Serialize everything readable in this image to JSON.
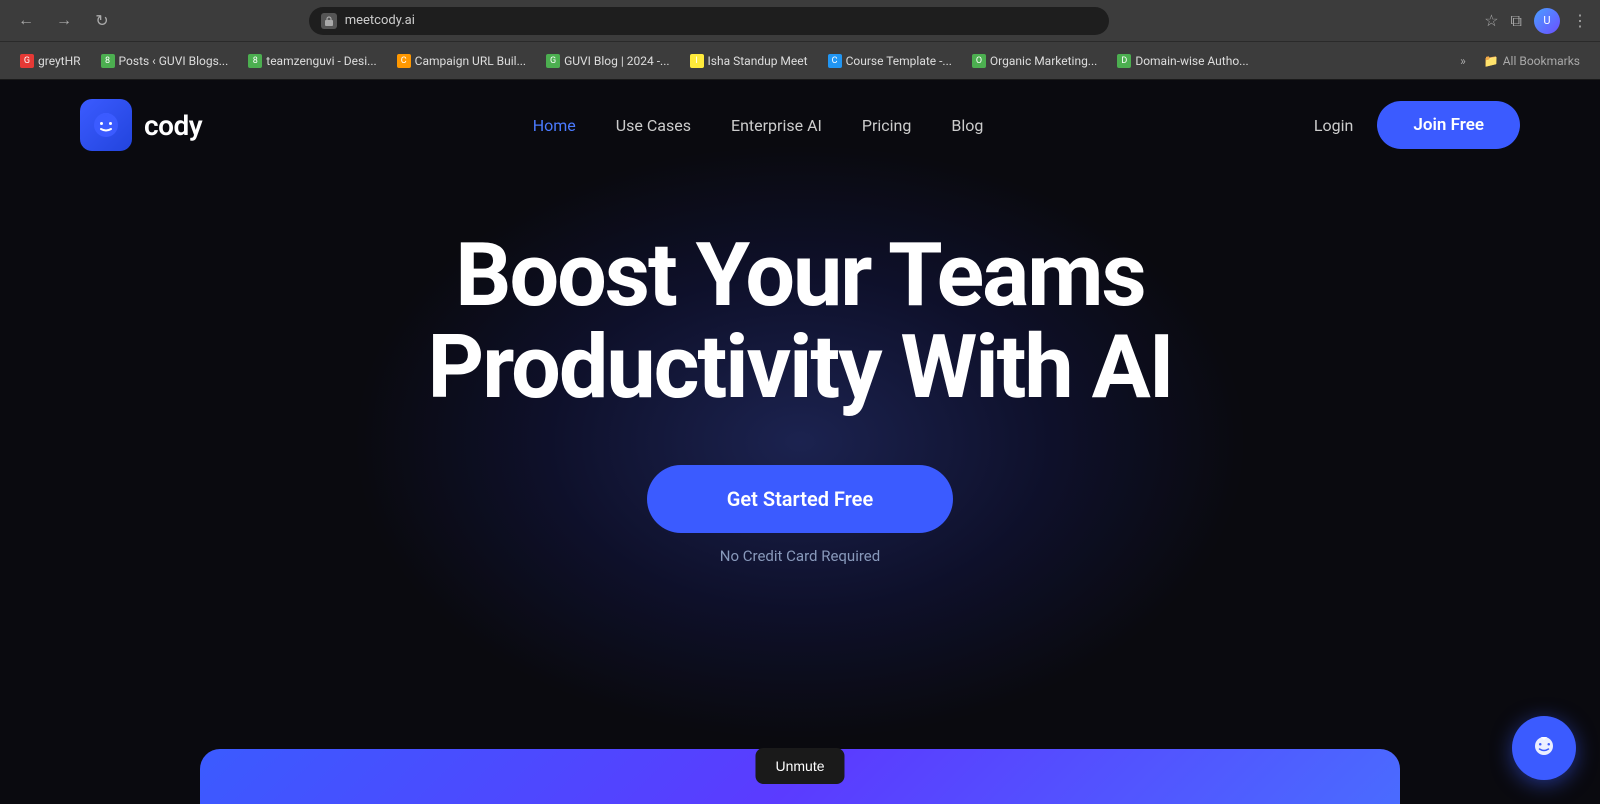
{
  "browser": {
    "address": "meetcody.ai",
    "back_label": "←",
    "forward_label": "→",
    "refresh_label": "↻",
    "more_label": "⋮",
    "bookmarks": [
      {
        "label": "greytHR",
        "color": "#e53935",
        "initial": "G"
      },
      {
        "label": "Posts ‹ GUVI Blogs...",
        "color": "#4caf50",
        "initial": "8"
      },
      {
        "label": "teamzenguvi - Desi...",
        "color": "#4caf50",
        "initial": "8"
      },
      {
        "label": "Campaign URL Buil...",
        "color": "#ff9800",
        "initial": "C"
      },
      {
        "label": "GUVI Blog | 2024 -...",
        "color": "#4caf50",
        "initial": "G"
      },
      {
        "label": "Isha Standup Meet",
        "color": "#ffeb3b",
        "initial": "I"
      },
      {
        "label": "Course Template -...",
        "color": "#2196f3",
        "initial": "C"
      },
      {
        "label": "Organic Marketing...",
        "color": "#4caf50",
        "initial": "O"
      },
      {
        "label": "Domain-wise Autho...",
        "color": "#4caf50",
        "initial": "D"
      }
    ],
    "all_bookmarks_label": "All Bookmarks"
  },
  "nav": {
    "logo_text": "cody",
    "links": [
      {
        "label": "Home",
        "active": true
      },
      {
        "label": "Use Cases",
        "active": false
      },
      {
        "label": "Enterprise AI",
        "active": false
      },
      {
        "label": "Pricing",
        "active": false
      },
      {
        "label": "Blog",
        "active": false
      }
    ],
    "login_label": "Login",
    "join_label": "Join Free"
  },
  "hero": {
    "title_line1": "Boost Your Teams",
    "title_line2": "Productivity With AI",
    "cta_button": "Get Started Free",
    "no_cc_text": "No Credit Card Required"
  },
  "chat_widget": {
    "label": "Chat"
  },
  "unmute_btn": {
    "label": "Unmute"
  }
}
